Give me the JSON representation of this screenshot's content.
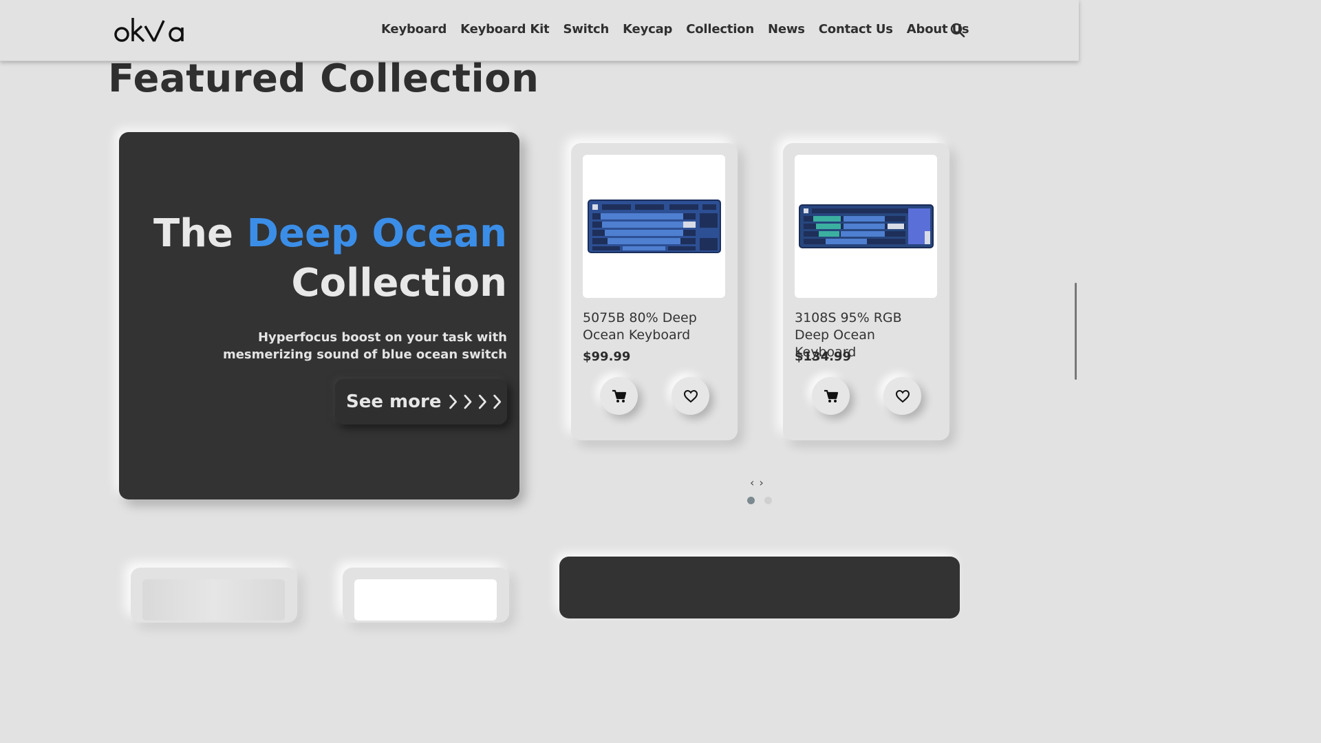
{
  "header": {
    "logo_text": "okʌa",
    "nav": [
      "Keyboard",
      "Keyboard Kit",
      "Switch",
      "Keycap",
      "Collection",
      "News",
      "Contact Us",
      "About Us"
    ],
    "search_icon": "search-icon"
  },
  "section": {
    "title": "Featured Collection"
  },
  "hero": {
    "title_prefix": "The ",
    "title_accent": "Deep Ocean",
    "title_line2": "Collection",
    "subtitle_line1": "Hyperfocus boost on your task with",
    "subtitle_line2": "mesmerizing sound of blue ocean switch",
    "button_label": "See more",
    "accent_color": "#3b8ee8"
  },
  "products": [
    {
      "name": "5075B 80% Deep Ocean Keyboard",
      "price": "$99.99",
      "image": "tenkeyless-blue-keyboard"
    },
    {
      "name": "3108S 95% RGB Deep Ocean Keyboard",
      "price": "$134.99",
      "image": "rgb-blue-keyboard"
    }
  ],
  "carousel": {
    "prev": "‹",
    "next": "›",
    "active_dot": 1,
    "dot_count": 2
  }
}
